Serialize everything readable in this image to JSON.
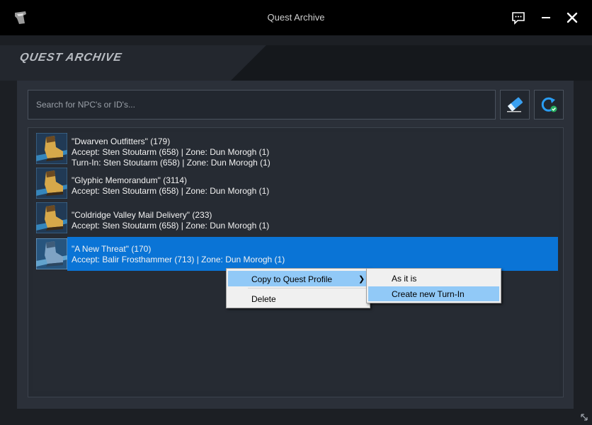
{
  "window": {
    "title": "Quest Archive",
    "icons": {
      "logo": "app-logo-icon",
      "feedback": "chat-bubble-icon",
      "minimize": "minimize-icon",
      "close": "close-icon"
    }
  },
  "header": {
    "section_title": "QUEST ARCHIVE"
  },
  "search": {
    "placeholder": "Search for NPC's or ID's...",
    "value": "",
    "clear_icon": "eraser-icon",
    "refresh_icon": "refresh-check-icon"
  },
  "quests": [
    {
      "title": "\"Dwarven Outfitters\" (179)",
      "accept": "Accept: Sten Stoutarm (658) | Zone: Dun Morogh (1)",
      "turnin": "Turn-In: Sten Stoutarm (658) | Zone: Dun Morogh (1)",
      "icon": "boots-icon",
      "selected": false
    },
    {
      "title": "\"Glyphic Memorandum\" (3114)",
      "accept": "Accept: Sten Stoutarm (658) | Zone: Dun Morogh (1)",
      "icon": "boots-icon",
      "selected": false
    },
    {
      "title": "\"Coldridge Valley Mail Delivery\" (233)",
      "accept": "Accept: Sten Stoutarm (658) | Zone: Dun Morogh (1)",
      "icon": "boots-icon",
      "selected": false
    },
    {
      "title": "\"A New Threat\" (170)",
      "accept": "Accept: Balir Frosthammer (713) | Zone: Dun Morogh (1)",
      "icon": "boots-icon",
      "selected": true
    }
  ],
  "context_menu": {
    "items": [
      "Copy to Quest Profile",
      "Delete"
    ],
    "submenu_arrow": "chevron-right-icon",
    "submenu": [
      "As it is",
      "Create new Turn-In"
    ]
  },
  "colors": {
    "titlebar": "#000000",
    "panel": "#2b3039",
    "selection": "#0a74d6",
    "menu_highlight": "#91c9f7"
  }
}
